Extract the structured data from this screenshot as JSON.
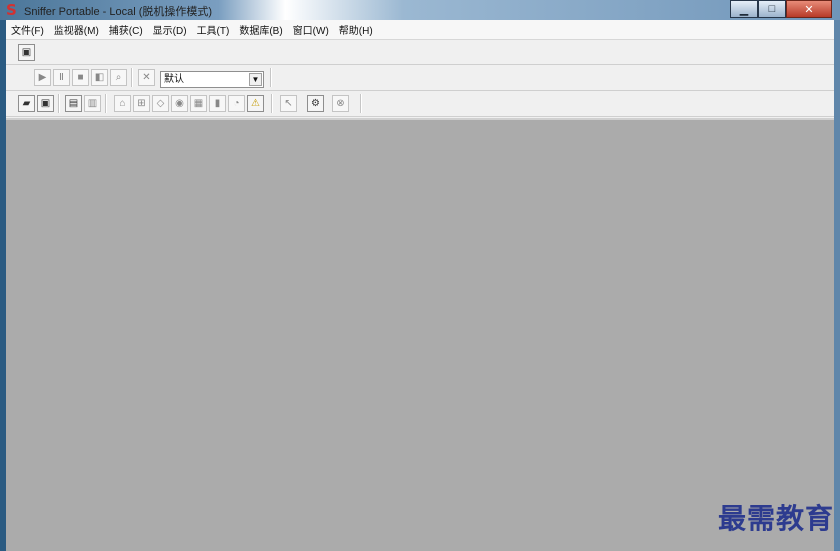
{
  "window": {
    "title": "Sniffer Portable - Local (脱机操作模式)",
    "app_icon": "S",
    "controls": {
      "minimize": "▁",
      "maximize": "□",
      "close": "✕"
    }
  },
  "menu": [
    "文件(F)",
    "监视器(M)",
    "捕获(C)",
    "显示(D)",
    "工具(T)",
    "数据库(B)",
    "窗口(W)",
    "帮助(H)"
  ],
  "toolbar": {
    "monitor_icon": "monitor-icon",
    "capture_icons": [
      "play-icon",
      "pause-icon",
      "stop-icon",
      "stop-display-icon",
      "binoculars-icon",
      "filter-off-icon"
    ],
    "profile_select": "默认",
    "file_icons": [
      "open-folder-icon",
      "save-icon",
      "print-icon",
      "print-preview-icon",
      "house-icon",
      "lan-icon",
      "switch-icon",
      "eye-icon",
      "matrix-icon",
      "chart-icon",
      "pie-icon",
      "warning-icon",
      "select-icon",
      "tools-icon",
      "stop-circle-icon"
    ]
  },
  "workspace": {
    "background": "#ababab"
  },
  "watermark": "最需教育"
}
